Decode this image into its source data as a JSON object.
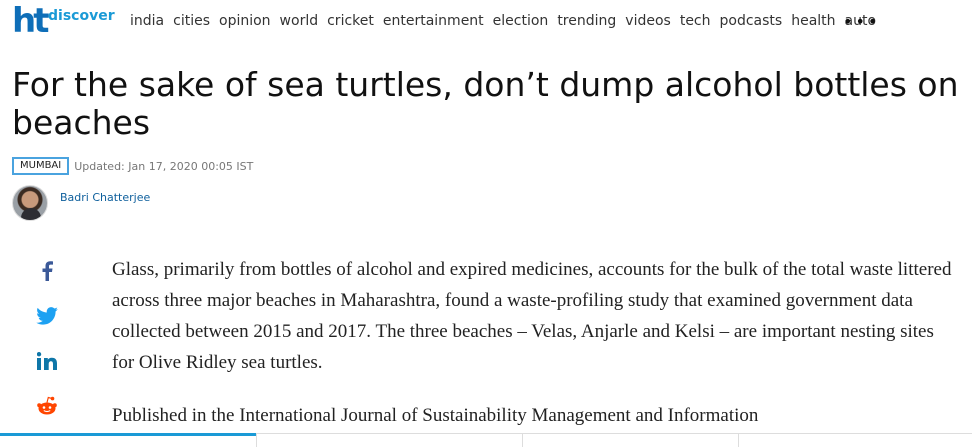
{
  "brand": {
    "logo": "ht",
    "section": "discover"
  },
  "nav": {
    "items": [
      "india",
      "cities",
      "opinion",
      "world",
      "cricket",
      "entertainment",
      "election",
      "trending",
      "videos",
      "tech",
      "podcasts",
      "health",
      "auto"
    ],
    "more": "•••"
  },
  "article": {
    "headline": "For the sake of sea turtles, don’t dump alcohol bottles on beaches",
    "section_badge": "MUMBAI",
    "updated": "Updated: Jan 17, 2020 00:05 IST",
    "author": "Badri Chatterjee",
    "paragraphs": [
      "Glass, primarily from bottles of alcohol and expired medicines, accounts for the bulk of the total waste littered across three major beaches in Maharashtra, found a waste-profiling study that examined government data collected between 2015 and 2017. The three beaches – Velas, Anjarle and Kelsi – are important nesting sites for Olive Ridley sea turtles.",
      "Published in the International Journal of Sustainability Management and Information"
    ]
  },
  "share": [
    {
      "name": "facebook",
      "color": "#3b5998"
    },
    {
      "name": "twitter",
      "color": "#1da1f2"
    },
    {
      "name": "linkedin",
      "color": "#0e76a8"
    },
    {
      "name": "reddit",
      "color": "#ff4500"
    }
  ],
  "colors": {
    "accent": "#1a9ad6",
    "logo": "#0e6eb8",
    "author": "#0e5f9c"
  }
}
